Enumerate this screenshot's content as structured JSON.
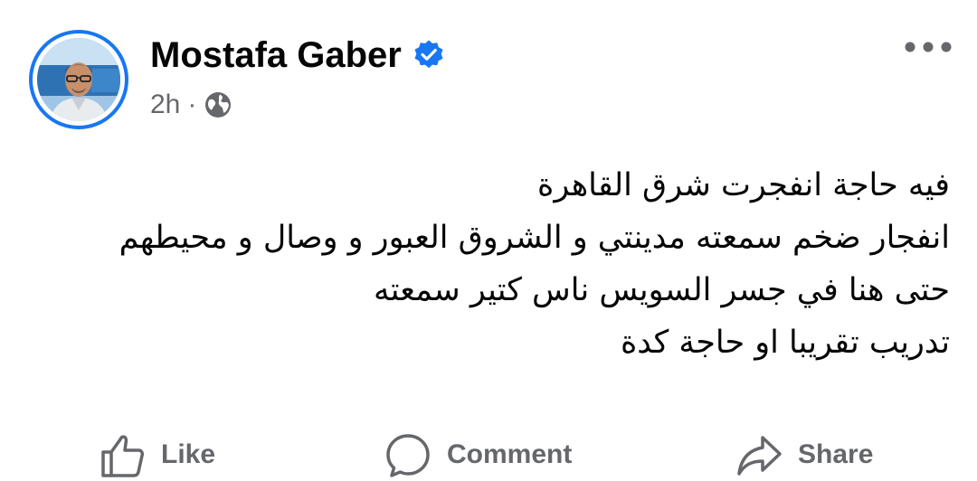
{
  "post": {
    "author_name": "Mostafa Gaber",
    "timestamp": "2h",
    "separator": "·",
    "privacy_icon": "globe-icon",
    "verified_icon": "verified-badge-icon",
    "more_icon": "more-horizontal-icon",
    "body_lines": [
      "فيه حاجة انفجرت شرق القاهرة",
      "انفجار ضخم سمعته مدينتي و الشروق العبور و وصال و محيطهم",
      "حتى هنا في جسر السويس ناس كتير سمعته",
      "تدريب تقريبا او حاجة كدة"
    ]
  },
  "actions": {
    "like_label": "Like",
    "comment_label": "Comment",
    "share_label": "Share"
  },
  "colors": {
    "accent": "#1877f2",
    "text_primary": "#050505",
    "text_secondary": "#65676b",
    "background": "#ffffff"
  }
}
